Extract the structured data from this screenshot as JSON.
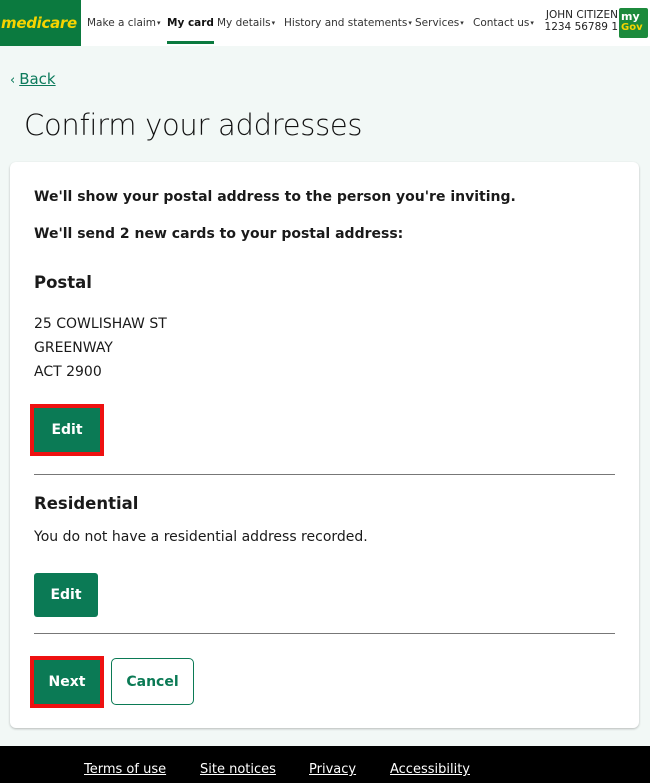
{
  "header": {
    "logo": "medicare",
    "nav": [
      {
        "label": "Make a claim",
        "caret": "▾"
      },
      {
        "label": "My card",
        "active": true
      },
      {
        "label": "My details",
        "caret": "▾"
      },
      {
        "label": "History and statements",
        "caret": "▾"
      },
      {
        "label": "Services",
        "caret": "▾"
      },
      {
        "label": "Contact us",
        "caret": "▾"
      }
    ],
    "user_name": "JOHN CITIZEN",
    "card_number": "1234 56789 1",
    "mygov_top": "my",
    "mygov_bottom": "Gov"
  },
  "back": {
    "chevron": "‹",
    "label": "Back"
  },
  "page_title": "Confirm your addresses",
  "card": {
    "intro1": "We'll show your postal address to the person you're inviting.",
    "intro2": "We'll send 2 new cards to your postal address:",
    "postal": {
      "heading": "Postal",
      "lines": [
        "25 COWLISHAW ST",
        "GREENWAY",
        "ACT 2900"
      ],
      "edit_label": "Edit"
    },
    "residential": {
      "heading": "Residential",
      "text": "You do not have a residential address recorded.",
      "edit_label": "Edit"
    },
    "next_label": "Next",
    "cancel_label": "Cancel"
  },
  "footer": {
    "links": [
      "Terms of use",
      "Site notices",
      "Privacy",
      "Accessibility"
    ]
  }
}
